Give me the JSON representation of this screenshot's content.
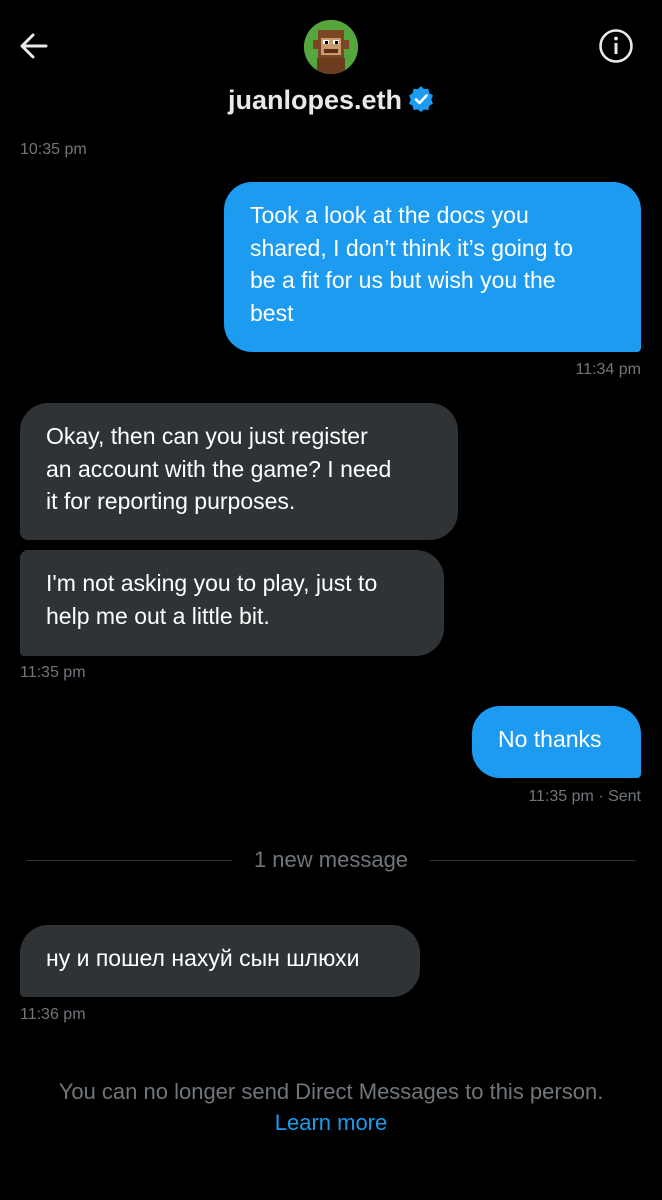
{
  "header": {
    "username": "juanlopes.eth",
    "back_icon": "arrow-left-icon",
    "info_icon": "info-icon",
    "verified_icon": "verified-badge-icon",
    "accent_color": "#1d9bf0"
  },
  "messages": [
    {
      "direction": "incoming",
      "timestamp": "10:35 pm"
    },
    {
      "direction": "outgoing",
      "lines": [
        "Took a look at the docs you",
        "shared, I don’t think it’s going to",
        "be a fit for us but wish you the",
        "best"
      ],
      "timestamp": "11:34 pm"
    },
    {
      "direction": "incoming",
      "lines": [
        "Okay, then can you just register",
        "an account with the game? I need",
        "it for reporting purposes."
      ]
    },
    {
      "direction": "incoming",
      "lines": [
        "I'm not asking you to play, just to",
        "help me out a little bit."
      ],
      "timestamp": "11:35 pm"
    },
    {
      "direction": "outgoing",
      "text": "No thanks",
      "timestamp": "11:35 pm",
      "status": "· Sent"
    },
    {
      "direction": "incoming",
      "text": "ну и пошел нахуй сын шлюхи",
      "timestamp": "11:36 pm"
    }
  ],
  "divider_label": "1 new message",
  "footer": {
    "notice": "You can no longer send Direct Messages to this person.",
    "link": "Learn more"
  },
  "colors": {
    "background": "#000000",
    "outgoing_bubble": "#1d9bf0",
    "incoming_bubble": "#2f3336",
    "muted_text": "#71767b"
  }
}
